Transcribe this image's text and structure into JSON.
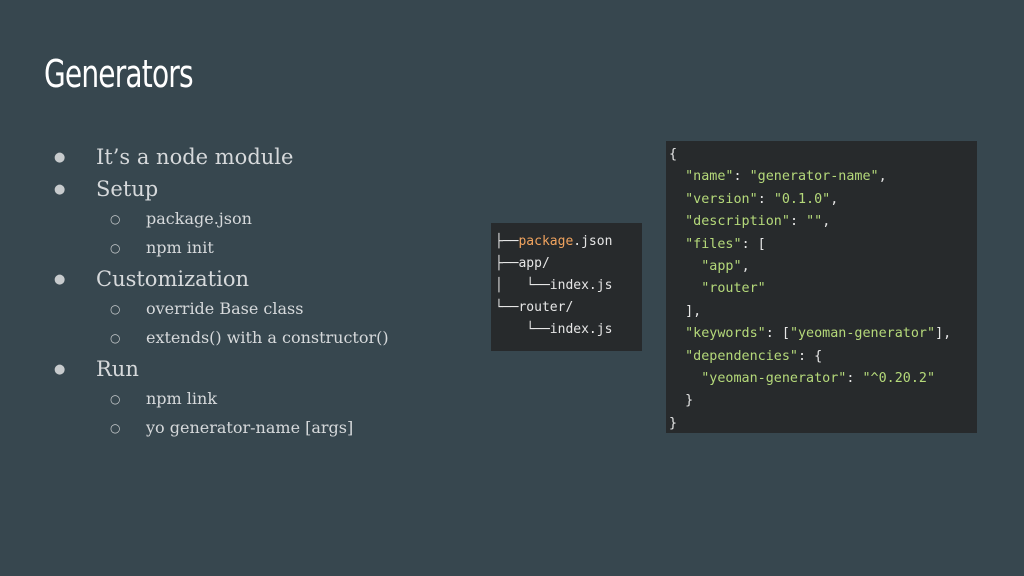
{
  "slide": {
    "title": "Generators",
    "bullets": [
      {
        "text": "It’s a node module",
        "children": []
      },
      {
        "text": "Setup",
        "children": [
          "package.json",
          "npm init"
        ]
      },
      {
        "text": "Customization",
        "children": [
          "override Base class",
          "extends() with a constructor()"
        ]
      },
      {
        "text": "Run",
        "children": [
          "npm link",
          "yo generator-name [args]"
        ]
      }
    ],
    "bullet_marker": "●",
    "sub_marker": "○"
  },
  "tree": {
    "lines": [
      {
        "prefix": "├──",
        "highlight": "package",
        "rest": ".json"
      },
      {
        "prefix": "├──",
        "highlight": "",
        "rest": "app/"
      },
      {
        "prefix": "│   └──",
        "highlight": "",
        "rest": "index.js"
      },
      {
        "prefix": "└──",
        "highlight": "",
        "rest": "router/"
      },
      {
        "prefix": "    └──",
        "highlight": "",
        "rest": "index.js"
      }
    ]
  },
  "json_code": {
    "lines": [
      {
        "pre": "{",
        "parts": []
      },
      {
        "pre": "  ",
        "parts": [
          [
            "s",
            "\"name\""
          ],
          [
            "p",
            ": "
          ],
          [
            "s",
            "\"generator-name\""
          ],
          [
            "p",
            ","
          ]
        ]
      },
      {
        "pre": "  ",
        "parts": [
          [
            "s",
            "\"version\""
          ],
          [
            "p",
            ": "
          ],
          [
            "s",
            "\"0.1.0\""
          ],
          [
            "p",
            ","
          ]
        ]
      },
      {
        "pre": "  ",
        "parts": [
          [
            "s",
            "\"description\""
          ],
          [
            "p",
            ": "
          ],
          [
            "s",
            "\"\""
          ],
          [
            "p",
            ","
          ]
        ]
      },
      {
        "pre": "  ",
        "parts": [
          [
            "s",
            "\"files\""
          ],
          [
            "p",
            ": ["
          ]
        ]
      },
      {
        "pre": "    ",
        "parts": [
          [
            "s",
            "\"app\""
          ],
          [
            "p",
            ","
          ]
        ]
      },
      {
        "pre": "    ",
        "parts": [
          [
            "s",
            "\"router\""
          ]
        ]
      },
      {
        "pre": "  ",
        "parts": [
          [
            "p",
            "],"
          ]
        ]
      },
      {
        "pre": "  ",
        "parts": [
          [
            "s",
            "\"keywords\""
          ],
          [
            "p",
            ": ["
          ],
          [
            "s",
            "\"yeoman-generator\""
          ],
          [
            "p",
            "],"
          ]
        ]
      },
      {
        "pre": "  ",
        "parts": [
          [
            "s",
            "\"dependencies\""
          ],
          [
            "p",
            ": {"
          ]
        ]
      },
      {
        "pre": "    ",
        "parts": [
          [
            "s",
            "\"yeoman-generator\""
          ],
          [
            "p",
            ": "
          ],
          [
            "s",
            "\"^0.20.2\""
          ]
        ]
      },
      {
        "pre": "  ",
        "parts": [
          [
            "p",
            "}"
          ]
        ]
      },
      {
        "pre": "}",
        "parts": []
      }
    ]
  },
  "colors": {
    "background": "#37474f",
    "code_background": "#272a2c",
    "string": "#b5d97a",
    "highlight": "#f0a35e"
  }
}
